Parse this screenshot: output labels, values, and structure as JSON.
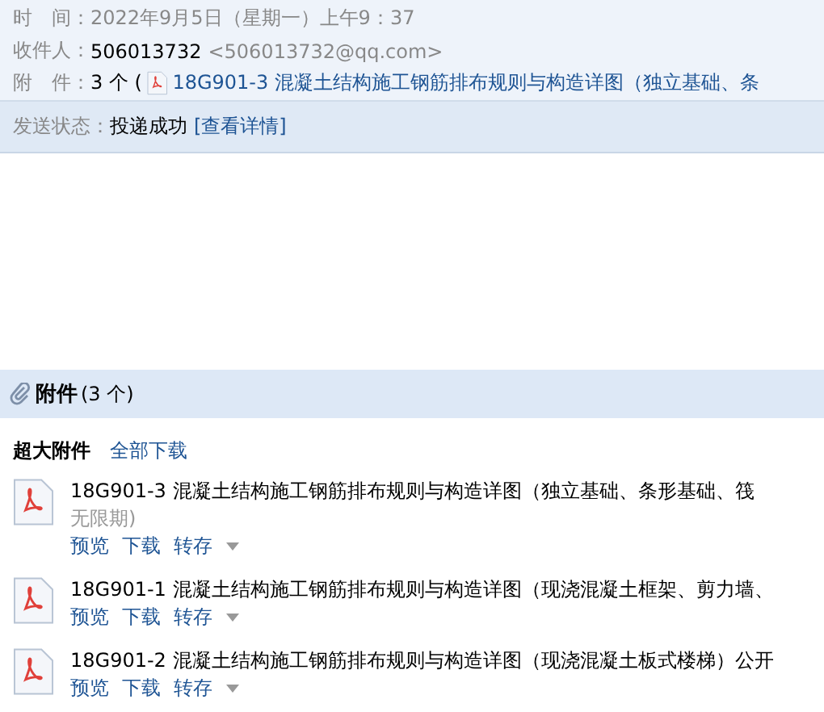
{
  "header": {
    "fields": [
      {
        "label": "时　间：",
        "value": "2022年9月5日（星期一）上午9：37",
        "kind": "plain"
      },
      {
        "label": "收件人：",
        "value": "506013732",
        "extra": "<506013732@qq.com>",
        "kind": "recipient"
      },
      {
        "label": "附　件：",
        "value": "3 个 (",
        "extra": "18G901-3 混凝土结构施工钢筋排布规则与构造详图（独立基础、条",
        "kind": "attachment"
      }
    ]
  },
  "status": {
    "label": "发送状态：",
    "value": "投递成功",
    "link": "[查看详情]"
  },
  "attachments": {
    "title": "附件",
    "count": "(3 个)",
    "group_label": "超大附件",
    "download_all": "全部下载",
    "items": [
      {
        "name": "18G901-3 混凝土结构施工钢筋排布规则与构造详图（独立基础、条形基础、筏",
        "note": "无限期)",
        "actions": [
          "预览",
          "下载",
          "转存"
        ]
      },
      {
        "name": "18G901-1 混凝土结构施工钢筋排布规则与构造详图（现浇混凝土框架、剪力墙、",
        "actions": [
          "预览",
          "下载",
          "转存"
        ]
      },
      {
        "name": "18G901-2 混凝土结构施工钢筋排布规则与构造详图（现浇混凝土板式楼梯）公开",
        "actions": [
          "预览",
          "下载",
          "转存"
        ]
      }
    ]
  }
}
